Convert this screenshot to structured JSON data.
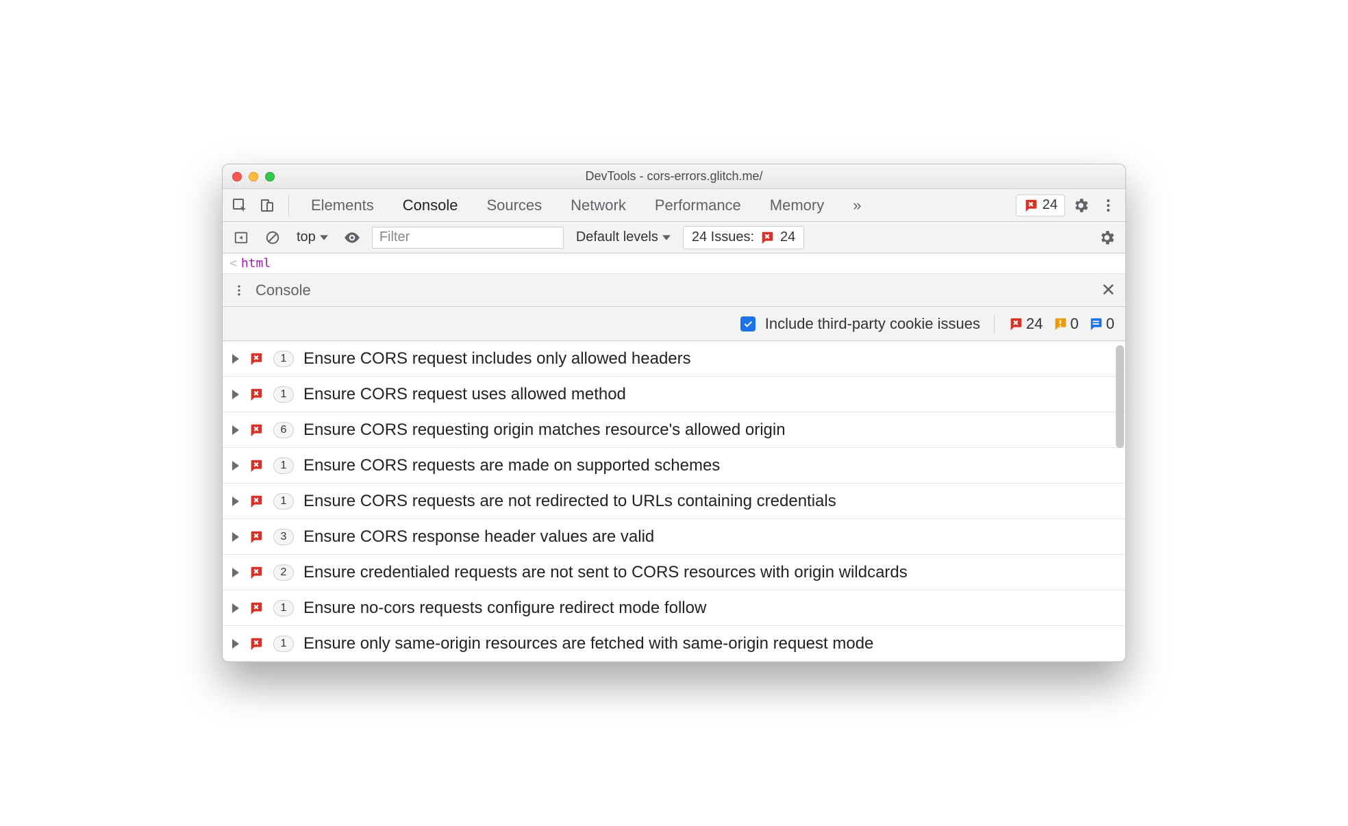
{
  "title": "DevTools - cors-errors.glitch.me/",
  "tabs": {
    "items": [
      "Elements",
      "Console",
      "Sources",
      "Network",
      "Performance",
      "Memory"
    ],
    "active": "Console",
    "more_glyph": "»"
  },
  "errbox": {
    "count": "24"
  },
  "toolbar": {
    "context_label": "top",
    "filter_placeholder": "Filter",
    "levels_label": "Default levels",
    "issues_label": "24 Issues:",
    "issues_count": "24"
  },
  "htmlline": {
    "chev": "<",
    "text": "html"
  },
  "console_drawer": {
    "label": "Console"
  },
  "cookiesrow": {
    "label": "Include third-party cookie issues",
    "error_count": "24",
    "warn_count": "0",
    "info_count": "0"
  },
  "issues": [
    {
      "count": "1",
      "title": "Ensure CORS request includes only allowed headers"
    },
    {
      "count": "1",
      "title": "Ensure CORS request uses allowed method"
    },
    {
      "count": "6",
      "title": "Ensure CORS requesting origin matches resource's allowed origin"
    },
    {
      "count": "1",
      "title": "Ensure CORS requests are made on supported schemes"
    },
    {
      "count": "1",
      "title": "Ensure CORS requests are not redirected to URLs containing credentials"
    },
    {
      "count": "3",
      "title": "Ensure CORS response header values are valid"
    },
    {
      "count": "2",
      "title": "Ensure credentialed requests are not sent to CORS resources with origin wildcards"
    },
    {
      "count": "1",
      "title": "Ensure no-cors requests configure redirect mode follow"
    },
    {
      "count": "1",
      "title": "Ensure only same-origin resources are fetched with same-origin request mode"
    }
  ]
}
